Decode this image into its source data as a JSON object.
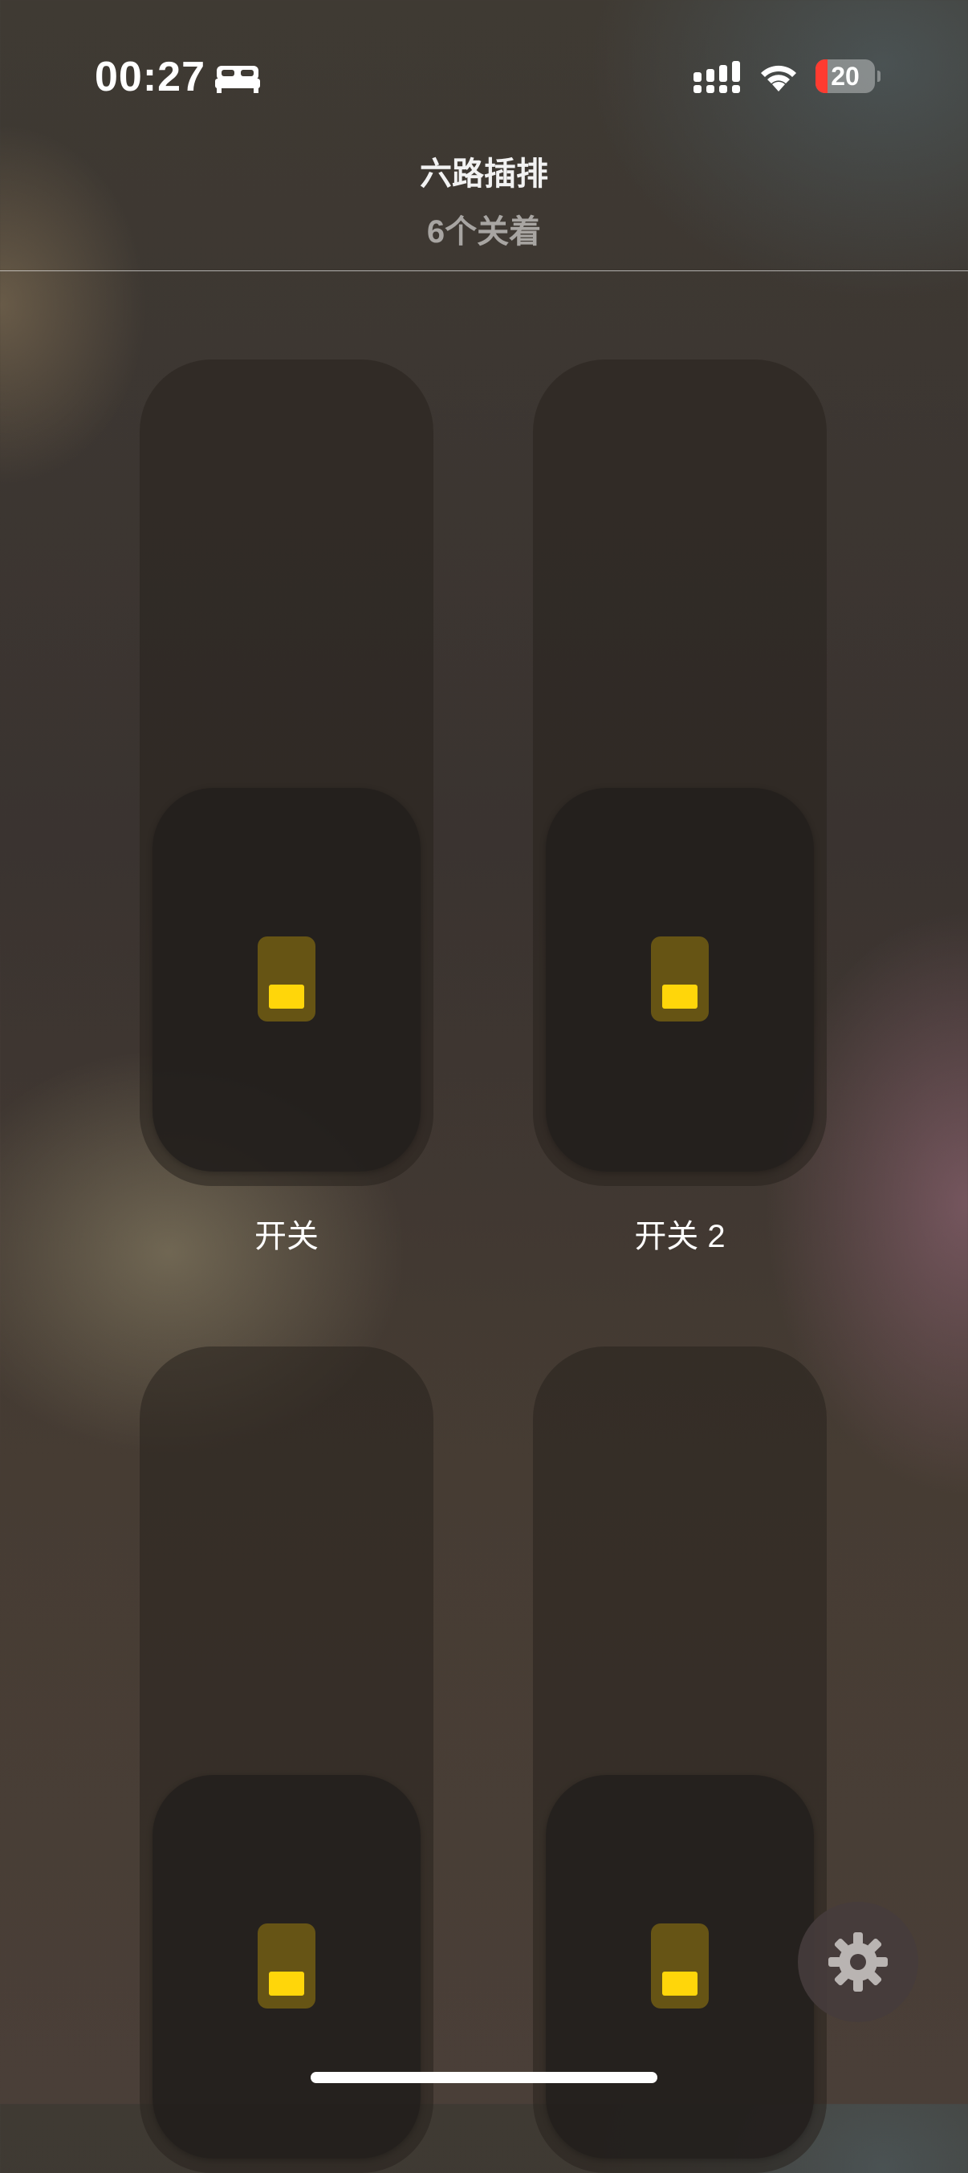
{
  "status_bar": {
    "time": "00:27",
    "battery_level": "20",
    "battery_fraction": 0.2,
    "icons": [
      "bed-icon",
      "signal-icon",
      "wifi-icon",
      "battery-icon"
    ]
  },
  "header": {
    "title": "六路插排",
    "subtitle": "6个关着"
  },
  "switches": [
    {
      "label": "开关",
      "state": "off"
    },
    {
      "label": "开关 2",
      "state": "off"
    },
    {
      "label": "",
      "state": "off"
    },
    {
      "label": "",
      "state": "off"
    }
  ],
  "colors": {
    "accent_yellow": "#ffd60a",
    "battery_low": "#ff3b30"
  },
  "settings": {
    "icon": "gear-icon"
  }
}
